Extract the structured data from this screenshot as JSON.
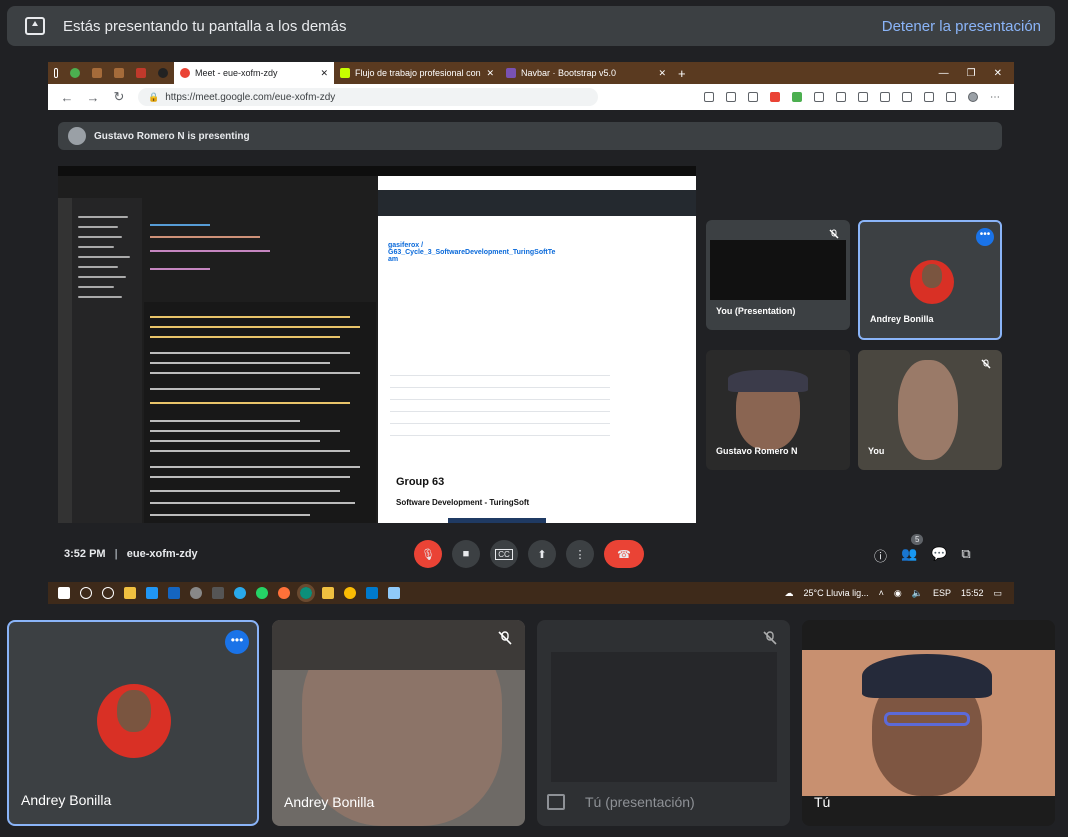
{
  "banner": {
    "text": "Estás presentando tu pantalla a los demás",
    "stop_label": "Detener la presentación"
  },
  "browser": {
    "tabs": [
      {
        "label": "Meet - eue-xofm-zdy",
        "active": true
      },
      {
        "label": "Flujo de trabajo profesional con",
        "active": false
      },
      {
        "label": "Navbar · Bootstrap v5.0",
        "active": false
      }
    ],
    "url": "https://meet.google.com/eue-xofm-zdy"
  },
  "inner_meet": {
    "presenting_text": "Gustavo Romero N is presenting",
    "tiles": [
      {
        "name": "You (Presentation)",
        "muted": true
      },
      {
        "name": "Andrey Bonilla",
        "selected": true
      },
      {
        "name": "Gustavo Romero N",
        "muted": false
      },
      {
        "name": "You",
        "muted": true
      }
    ],
    "time": "3:52 PM",
    "meeting_code": "eue-xofm-zdy",
    "participants_count": "5",
    "github": {
      "repo_owner": "gasiferox /",
      "repo_name": "G63_Cycle_3_SoftwareDevelopment_TuringSoftTeam",
      "group_title": "Group 63",
      "subtitle": "Software Development - TuringSoft"
    }
  },
  "taskbar": {
    "weather": "25°C  Lluvia lig...",
    "lang": "ESP",
    "clock": "15:52"
  },
  "bottom_tiles": [
    {
      "name": "Andrey Bonilla",
      "selected": true
    },
    {
      "name": "Andrey Bonilla",
      "muted": true
    },
    {
      "name": "Tú (presentación)",
      "muted": true
    },
    {
      "name": "Tú"
    }
  ],
  "colors": {
    "accent": "#8ab4f8",
    "hangup": "#ea4335",
    "tile_bg": "#3c4043"
  }
}
